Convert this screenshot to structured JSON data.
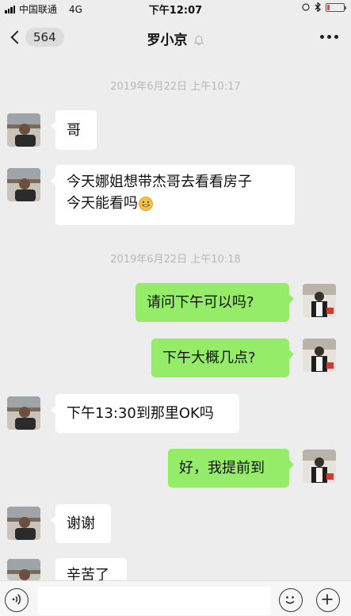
{
  "status_bar": {
    "carrier": "中国联通",
    "network": "4G",
    "time": "下午12:07",
    "battery_level": 0.15,
    "battery_color": "#e34a3c"
  },
  "header": {
    "back_count": "564",
    "title": "罗小京",
    "title_icon": "bell-off-icon",
    "more_icon": "more-dots-icon"
  },
  "timestamps": [
    "2019年6月22日 上午10:17",
    "2019年6月22日 上午10:18"
  ],
  "messages": [
    {
      "side": "left",
      "lines": [
        "哥"
      ]
    },
    {
      "side": "left",
      "lines": [
        "今天娜姐想带杰哥去看看房子",
        "今天能看吗"
      ],
      "emoji": "grin-sweat-emoji-icon"
    },
    {
      "side": "right",
      "lines": [
        "请问下午可以吗?"
      ]
    },
    {
      "side": "right",
      "lines": [
        "下午大概几点?"
      ]
    },
    {
      "side": "left",
      "lines": [
        "下午13:30到那里OK吗"
      ]
    },
    {
      "side": "right",
      "lines": [
        "好，我提前到"
      ]
    },
    {
      "side": "left",
      "lines": [
        "谢谢"
      ]
    },
    {
      "side": "left",
      "lines": [
        "辛苦了"
      ]
    }
  ],
  "input_bar": {
    "voice_icon": "voice-icon",
    "emoji_icon": "smile-icon",
    "plus_icon": "plus-icon",
    "input_value": ""
  },
  "colors": {
    "background": "#ededed",
    "bubble_sent": "#95ec69",
    "bubble_received": "#ffffff",
    "timestamp": "#b8b8b8"
  }
}
